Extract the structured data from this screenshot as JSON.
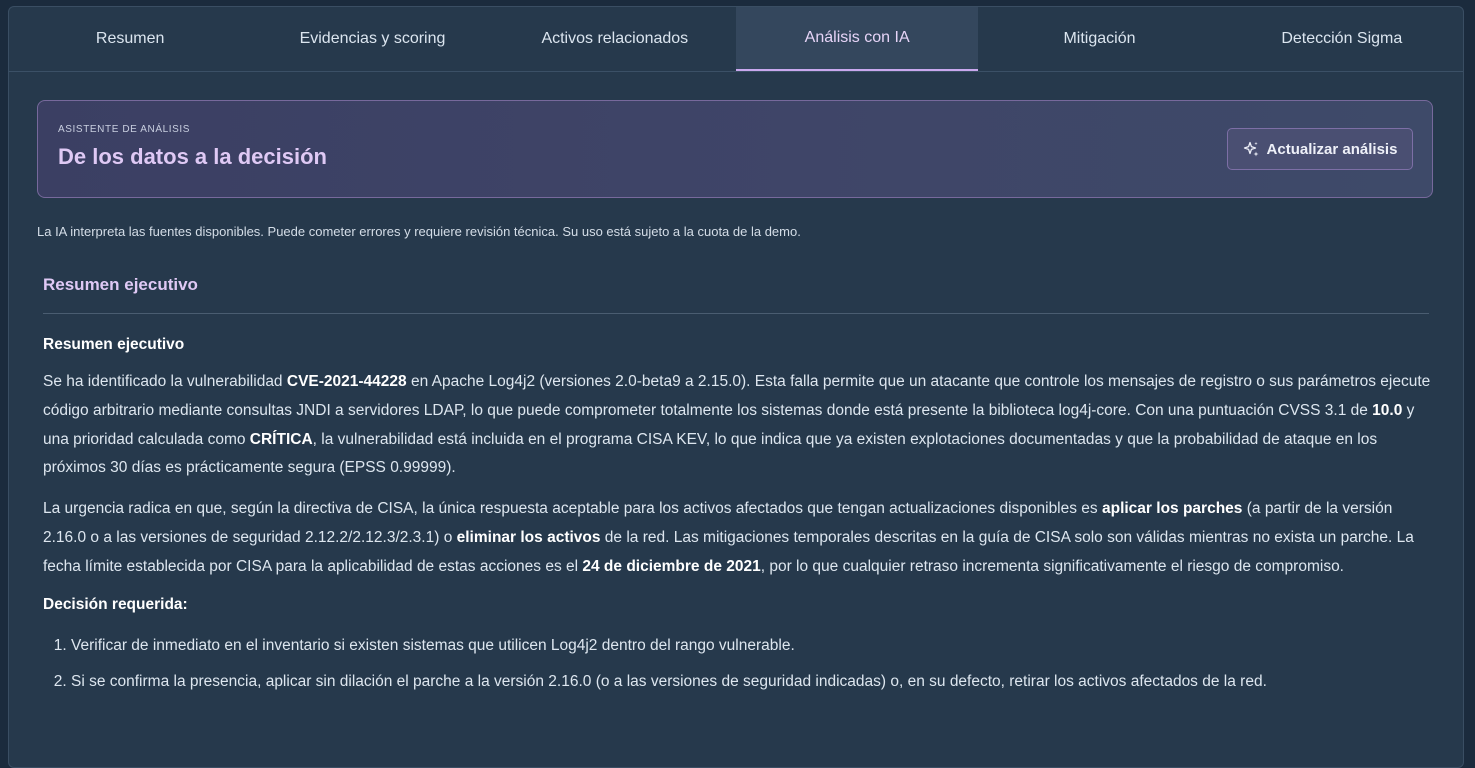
{
  "tabs": [
    {
      "label": "Resumen",
      "active": false
    },
    {
      "label": "Evidencias y scoring",
      "active": false
    },
    {
      "label": "Activos relacionados",
      "active": false
    },
    {
      "label": "Análisis con IA",
      "active": true
    },
    {
      "label": "Mitigación",
      "active": false
    },
    {
      "label": "Detección Sigma",
      "active": false
    }
  ],
  "hero": {
    "eyebrow": "ASISTENTE DE ANÁLISIS",
    "title": "De los datos a la decisión",
    "button_label": "Actualizar análisis",
    "button_icon": "sparkle-icon"
  },
  "disclaimer": "La IA interpreta las fuentes disponibles. Puede cometer errores y requiere revisión técnica. Su uso está sujeto a la cuota de la demo.",
  "section": {
    "title": "Resumen ejecutivo"
  },
  "report": {
    "heading": "Resumen ejecutivo",
    "p1": {
      "t1": "Se ha identificado la vulnerabilidad ",
      "b1": "CVE-2021-44228",
      "t2": " en Apache Log4j2 (versiones 2.0-beta9 a 2.15.0). Esta falla permite que un atacante que controle los mensajes de registro o sus parámetros ejecute código arbitrario mediante consultas JNDI a servidores LDAP, lo que puede comprometer totalmente los sistemas donde está presente la biblioteca log4j-core. Con una puntuación CVSS 3.1 de ",
      "b2": "10.0",
      "t3": " y una prioridad calculada como ",
      "b3": "CRÍTICA",
      "t4": ", la vulnerabilidad está incluida en el programa CISA KEV, lo que indica que ya existen explotaciones documentadas y que la probabilidad de ataque en los próximos 30 días es prácticamente segura (EPSS 0.99999)."
    },
    "p2": {
      "t1": "La urgencia radica en que, según la directiva de CISA, la única respuesta aceptable para los activos afectados que tengan actualizaciones disponibles es ",
      "b1": "aplicar los parches",
      "t2": " (a partir de la versión 2.16.0 o a las versiones de seguridad 2.12.2/2.12.3/2.3.1) o ",
      "b2": "eliminar los activos",
      "t3": " de la red. Las mitigaciones temporales descritas en la guía de CISA solo son válidas mientras no exista un parche. La fecha límite establecida por CISA para la aplicabilidad de estas acciones es el ",
      "b3": "24 de diciembre de 2021",
      "t4": ", por lo que cualquier retraso incrementa significativamente el riesgo de compromiso."
    },
    "decision_heading": "Decisión requerida:",
    "decisions": [
      "Verificar de inmediato en el inventario si existen sistemas que utilicen Log4j2 dentro del rango vulnerable.",
      "Si se confirma la presencia, aplicar sin dilación el parche a la versión 2.16.0 (o a las versiones de seguridad indicadas) o, en su defecto, retirar los activos afectados de la red."
    ]
  },
  "colors": {
    "background": "#1b2b3d",
    "panel": "#26394c",
    "accent": "#c9a8ee"
  }
}
